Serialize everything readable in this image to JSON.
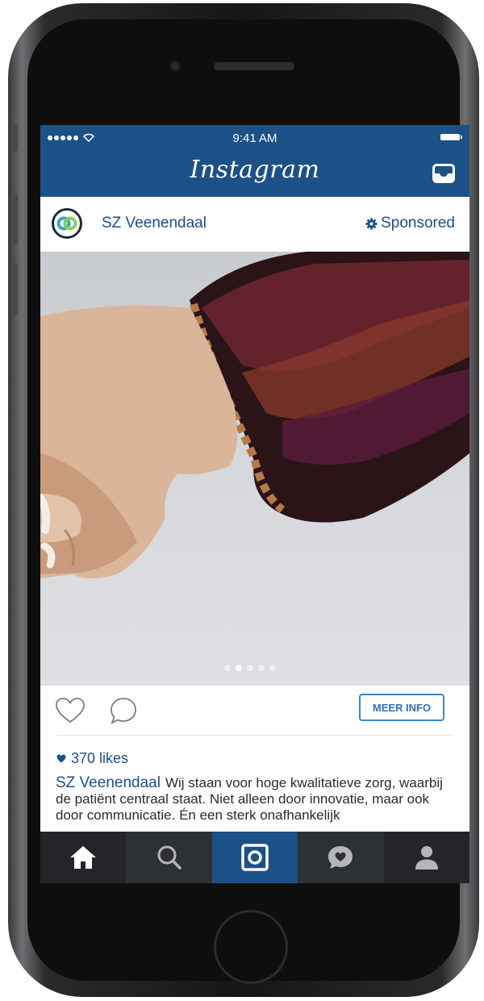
{
  "status_bar": {
    "time": "9:41 AM"
  },
  "app": {
    "title": "Instagram"
  },
  "post": {
    "username": "SZ Veenendaal",
    "sponsored_label": "Sponsored",
    "carousel": {
      "page_count": 5,
      "active_index": 1
    },
    "cta_label": "MEER INFO",
    "likes": "370 likes",
    "caption_user": "SZ Veenendaal",
    "caption_text": "Wij staan voor hoge kwalitatieve zorg, waarbij de patiënt centraal staat. Niet alleen door innovatie, maar ook door communicatie. Én een sterk onafhankelijk"
  },
  "tab_bar": {
    "tabs": [
      "home-icon",
      "search-icon",
      "camera-icon",
      "activity-icon",
      "profile-icon"
    ],
    "active_index": 2
  },
  "colors": {
    "brand_blue": "#1c5188",
    "link_blue": "#1c4f86",
    "button_blue": "#3b87c8",
    "tab_bar": "#2b2d31"
  }
}
